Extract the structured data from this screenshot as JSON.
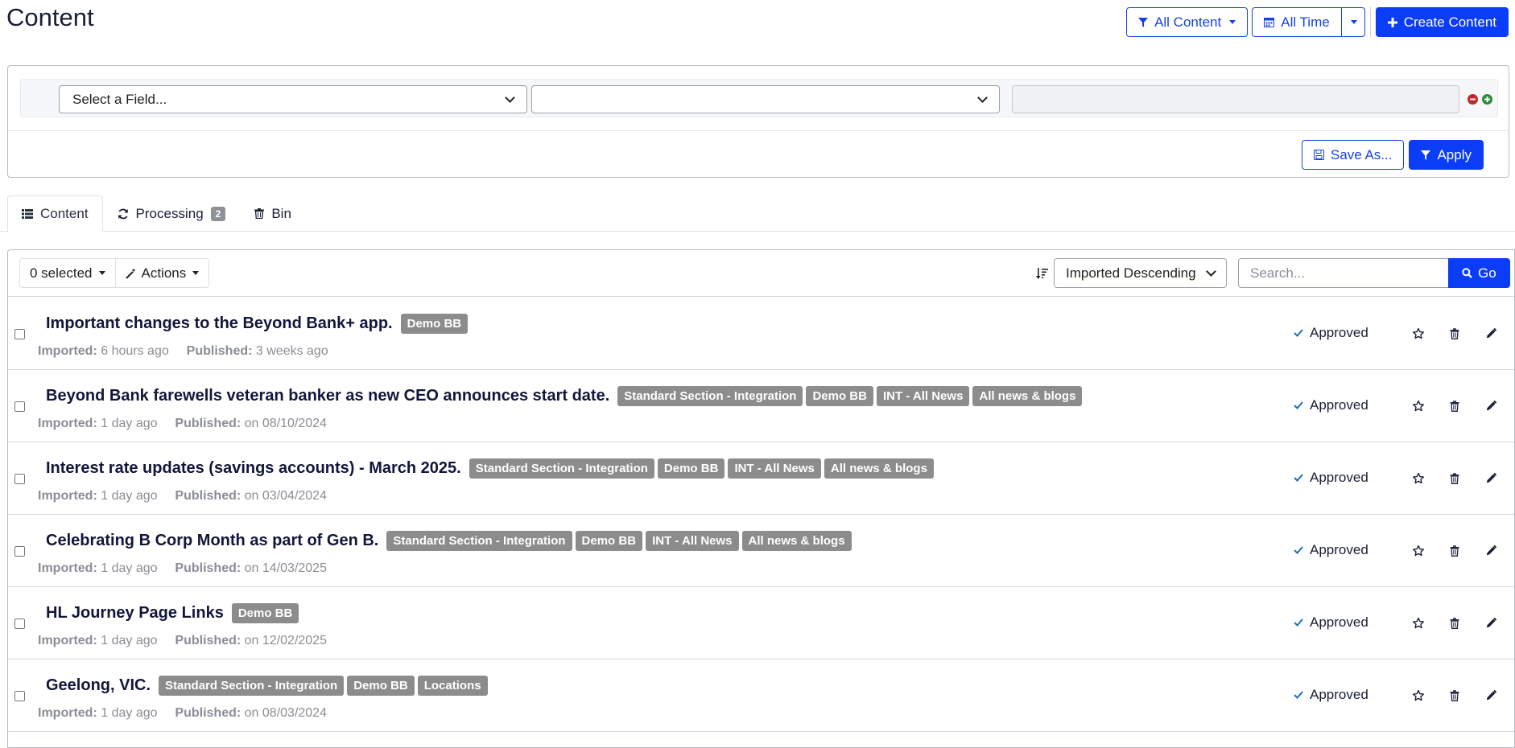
{
  "header": {
    "title": "Content",
    "filter_button": "All Content",
    "time_button": "All Time",
    "create_button": "Create Content"
  },
  "filter": {
    "field_select": "Select a Field...",
    "operator_select": "",
    "value": "",
    "save_as": "Save As...",
    "apply": "Apply"
  },
  "tabs": [
    {
      "label": "Content",
      "icon": "list-icon"
    },
    {
      "label": "Processing",
      "icon": "refresh-icon",
      "count": "2"
    },
    {
      "label": "Bin",
      "icon": "trash-icon"
    }
  ],
  "toolbar": {
    "selected": "0 selected",
    "actions": "Actions",
    "sort": "Imported Descending",
    "search_placeholder": "Search...",
    "go": "Go"
  },
  "labels": {
    "imported": "Imported:",
    "published": "Published:"
  },
  "rows": [
    {
      "title": "Important changes to the Beyond Bank+ app.",
      "tags": [
        "Demo BB"
      ],
      "imported": "6 hours ago",
      "published": "3 weeks ago",
      "status": "Approved"
    },
    {
      "title": "Beyond Bank farewells veteran banker as new CEO announces start date.",
      "tags": [
        "Standard Section - Integration",
        "Demo BB",
        "INT - All News",
        "All news & blogs"
      ],
      "imported": "1 day ago",
      "published": "on 08/10/2024",
      "status": "Approved"
    },
    {
      "title": "Interest rate updates (savings accounts) - March 2025.",
      "tags": [
        "Standard Section - Integration",
        "Demo BB",
        "INT - All News",
        "All news & blogs"
      ],
      "imported": "1 day ago",
      "published": "on 03/04/2024",
      "status": "Approved"
    },
    {
      "title": "Celebrating B Corp Month as part of Gen B.",
      "tags": [
        "Standard Section - Integration",
        "Demo BB",
        "INT - All News",
        "All news & blogs"
      ],
      "imported": "1 day ago",
      "published": "on 14/03/2025",
      "status": "Approved"
    },
    {
      "title": "HL Journey Page Links",
      "tags": [
        "Demo BB"
      ],
      "imported": "1 day ago",
      "published": "on 12/02/2025",
      "status": "Approved"
    },
    {
      "title": "Geelong, VIC.",
      "tags": [
        "Standard Section - Integration",
        "Demo BB",
        "Locations"
      ],
      "imported": "1 day ago",
      "published": "on 08/03/2024",
      "status": "Approved"
    }
  ],
  "colors": {
    "primary": "#0a3df5",
    "tag": "#8c8c8c",
    "approved_check": "#1f6fb5",
    "remove": "#c0282d",
    "add": "#2e8b3d"
  }
}
